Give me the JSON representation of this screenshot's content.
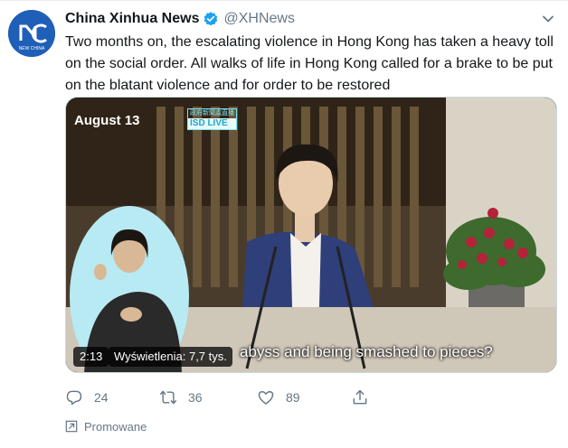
{
  "account": {
    "name": "China Xinhua News",
    "handle": "@XHNews",
    "avatar_text": "NEW CHINA",
    "verified": true
  },
  "tweet": {
    "text": "Two months on, the escalating violence in Hong Kong has taken a heavy toll on the social order. All walks of life in Hong Kong called for a brake to be put on the blatant violence and for order to be restored"
  },
  "video": {
    "date_overlay": "August 13",
    "channel_top": "政府新聞處直播",
    "channel_bottom": "ISD LIVE",
    "caption": "abyss and being smashed to pieces?",
    "duration": "2:13",
    "views": "Wyświetlenia: 7,7 tys."
  },
  "actions": {
    "reply_count": "24",
    "retweet_count": "36",
    "like_count": "89"
  },
  "promoted_label": "Promowane",
  "colors": {
    "verified": "#1da1f2",
    "secondary_text": "#657786",
    "avatar_bg": "#1f5fb7"
  },
  "icons": [
    "verified-badge-icon",
    "chevron-down-icon",
    "reply-icon",
    "retweet-icon",
    "like-icon",
    "share-icon",
    "promoted-arrow-icon"
  ]
}
